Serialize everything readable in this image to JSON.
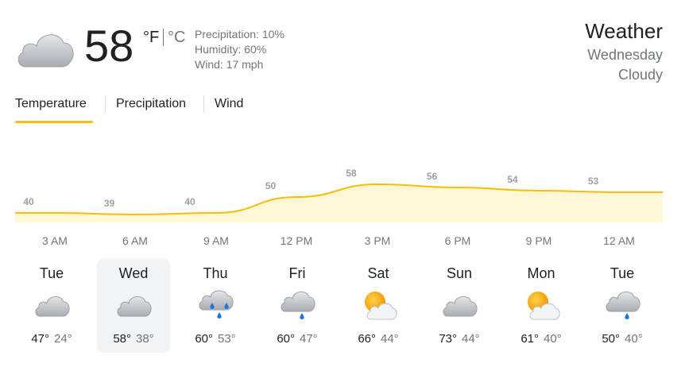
{
  "current": {
    "temperature": "58",
    "unit_f": "°F",
    "unit_c": "°C",
    "precipitation": "Precipitation: 10%",
    "humidity": "Humidity: 60%",
    "wind": "Wind: 17 mph",
    "icon": "cloudy-icon"
  },
  "header": {
    "title": "Weather",
    "day": "Wednesday",
    "condition": "Cloudy"
  },
  "tabs": [
    {
      "label": "Temperature",
      "selected": true
    },
    {
      "label": "Precipitation",
      "selected": false
    },
    {
      "label": "Wind",
      "selected": false
    }
  ],
  "colors": {
    "accent": "#fbbc04",
    "chart_fill": "#fef7d6",
    "selected_day_bg": "#f1f3f4"
  },
  "chart_data": {
    "type": "area",
    "x": [
      "3 AM",
      "6 AM",
      "9 AM",
      "12 PM",
      "3 PM",
      "6 PM",
      "9 PM",
      "12 AM"
    ],
    "values": [
      40,
      39,
      40,
      50,
      58,
      56,
      54,
      53
    ],
    "data_labels": [
      "40",
      "39",
      "40",
      "50",
      "58",
      "56",
      "54",
      "53"
    ]
  },
  "days": [
    {
      "name": "Tue",
      "high": "47°",
      "low": "24°",
      "icon": "cloudy-icon",
      "selected": false
    },
    {
      "name": "Wed",
      "high": "58°",
      "low": "38°",
      "icon": "cloudy-icon",
      "selected": true
    },
    {
      "name": "Thu",
      "high": "60°",
      "low": "53°",
      "icon": "rain-showers-icon",
      "selected": false
    },
    {
      "name": "Fri",
      "high": "60°",
      "low": "47°",
      "icon": "light-rain-icon",
      "selected": false
    },
    {
      "name": "Sat",
      "high": "66°",
      "low": "44°",
      "icon": "partly-sunny-icon",
      "selected": false
    },
    {
      "name": "Sun",
      "high": "73°",
      "low": "44°",
      "icon": "cloudy-icon",
      "selected": false
    },
    {
      "name": "Mon",
      "high": "61°",
      "low": "40°",
      "icon": "partly-sunny-icon",
      "selected": false
    },
    {
      "name": "Tue",
      "high": "50°",
      "low": "40°",
      "icon": "light-rain-icon",
      "selected": false
    }
  ]
}
